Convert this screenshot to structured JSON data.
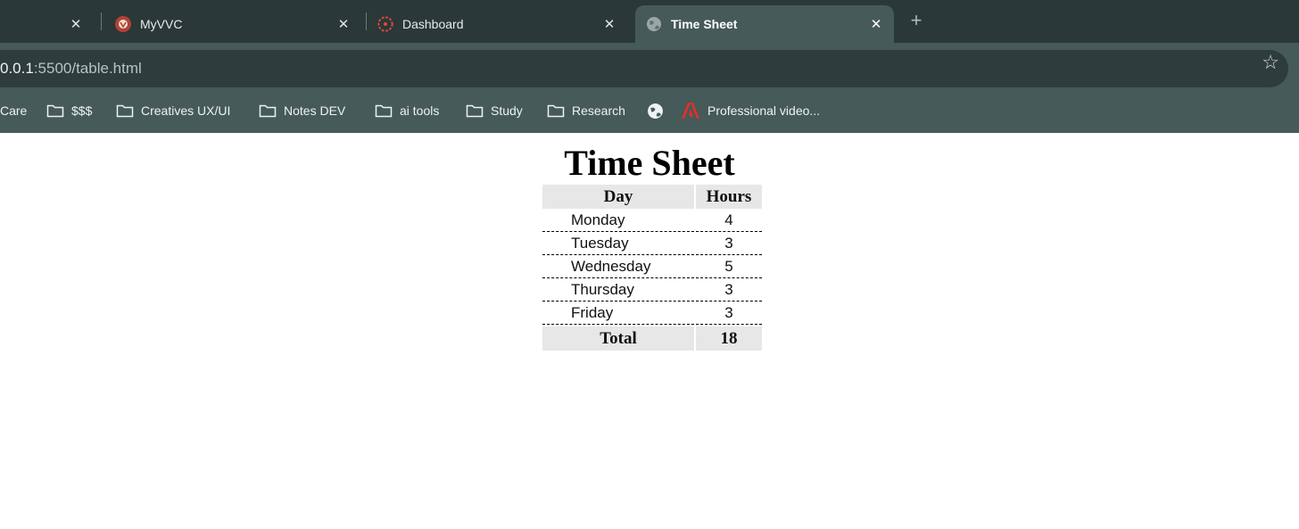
{
  "browser": {
    "tabs": [
      {
        "title": "",
        "icon": "none"
      },
      {
        "title": "MyVVC",
        "icon": "myvvc-logo-icon"
      },
      {
        "title": "Dashboard",
        "icon": "canvas-logo-icon"
      },
      {
        "title": "Time Sheet",
        "icon": "globe-icon",
        "active": true
      }
    ],
    "new_tab_symbol": "+",
    "close_symbol": "✕",
    "url_host": "0.0.1",
    "url_rest": ":5500/table.html",
    "star_symbol": "☆",
    "bookmarks": [
      {
        "label": "Care",
        "icon": "none"
      },
      {
        "label": "$$$",
        "icon": "folder-icon"
      },
      {
        "label": "Creatives UX/UI",
        "icon": "folder-icon"
      },
      {
        "label": "Notes DEV",
        "icon": "folder-icon"
      },
      {
        "label": "ai tools",
        "icon": "folder-icon"
      },
      {
        "label": "Study",
        "icon": "folder-icon"
      },
      {
        "label": "Research",
        "icon": "folder-icon"
      },
      {
        "label": "",
        "icon": "globe-icon"
      },
      {
        "label": "Professional video...",
        "icon": "adobe-icon"
      }
    ]
  },
  "page": {
    "heading": "Time Sheet",
    "table": {
      "headers": {
        "day": "Day",
        "hours": "Hours"
      },
      "rows": [
        {
          "day": "Monday",
          "hours": "4"
        },
        {
          "day": "Tuesday",
          "hours": "3"
        },
        {
          "day": "Wednesday",
          "hours": "5"
        },
        {
          "day": "Thursday",
          "hours": "3"
        },
        {
          "day": "Friday",
          "hours": "3"
        }
      ],
      "total": {
        "label": "Total",
        "value": "18"
      }
    }
  },
  "colors": {
    "tab_strip": "#2a3838",
    "toolbar": "#465a59",
    "omnibox": "#2e3c3c",
    "table_header_bg": "#e7e7e7"
  }
}
